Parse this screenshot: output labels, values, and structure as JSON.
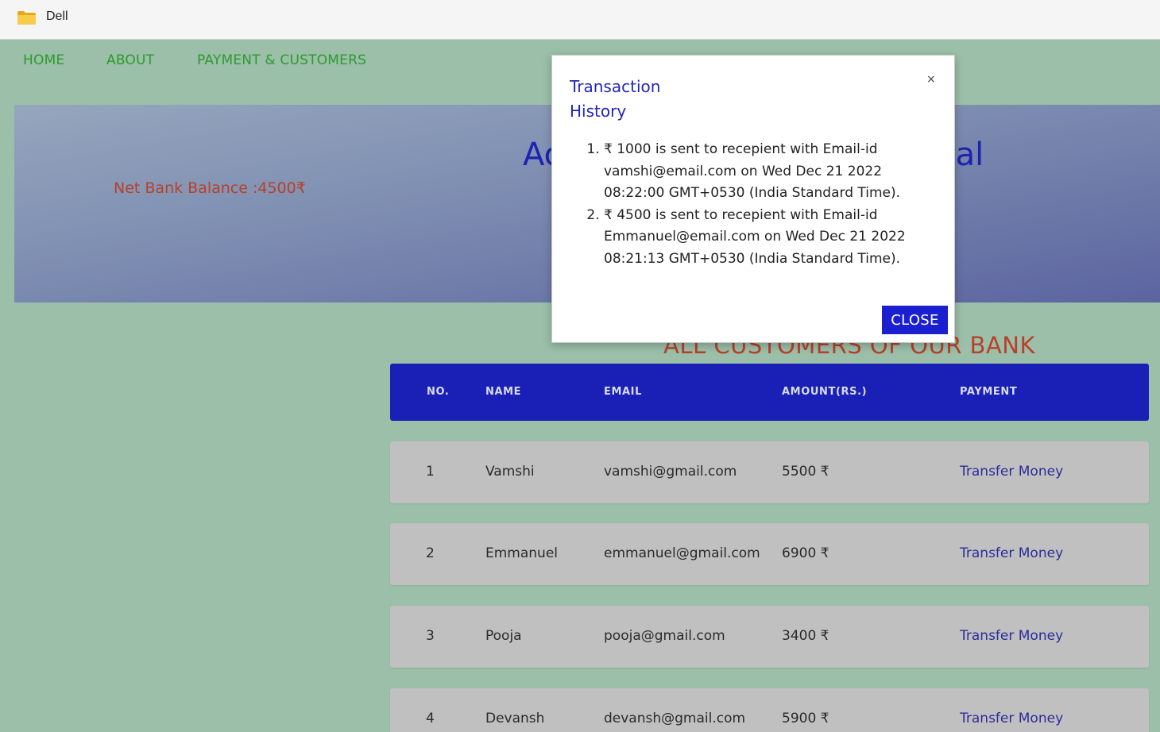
{
  "window": {
    "title": "Dell",
    "icon": "folder-icon"
  },
  "nav": {
    "items": [
      "HOME",
      "ABOUT",
      "PAYMENT & CUSTOMERS"
    ]
  },
  "banner": {
    "balance": "Net Bank Balance :4500₹",
    "heading_left": "Ac",
    "heading_right": "al"
  },
  "customers": {
    "section_title": "ALL CUSTOMERS OF OUR BANK",
    "columns": [
      "NO.",
      "NAME",
      "EMAIL",
      "AMOUNT(RS.)",
      "PAYMENT"
    ],
    "rows": [
      {
        "no": "1",
        "name": "Vamshi",
        "email": "vamshi@gmail.com",
        "amount": "5500 ₹",
        "action": "Transfer Money"
      },
      {
        "no": "2",
        "name": "Emmanuel",
        "email": "emmanuel@gmail.com",
        "amount": "6900 ₹",
        "action": "Transfer Money"
      },
      {
        "no": "3",
        "name": "Pooja",
        "email": "pooja@gmail.com",
        "amount": "3400 ₹",
        "action": "Transfer Money"
      },
      {
        "no": "4",
        "name": "Devansh",
        "email": "devansh@gmail.com",
        "amount": "5900 ₹",
        "action": "Transfer Money"
      }
    ]
  },
  "modal": {
    "title": "Transaction History",
    "close_x": "×",
    "transactions": [
      "₹ 1000 is sent to recepient with Email-id vamshi@email.com on Wed Dec 21 2022 08:22:00 GMT+0530 (India Standard Time).",
      "₹ 4500 is sent to recepient with Email-id Emmanuel@email.com on Wed Dec 21 2022 08:21:13 GMT+0530 (India Standard Time)."
    ],
    "close_button": "CLOSE"
  },
  "colors": {
    "page_bg": "#9bbfa9",
    "nav_text": "#2e9a2e",
    "accent_blue": "#1a1fb6",
    "balance_text": "#b8402a",
    "row_bg": "#c0c0c0"
  }
}
